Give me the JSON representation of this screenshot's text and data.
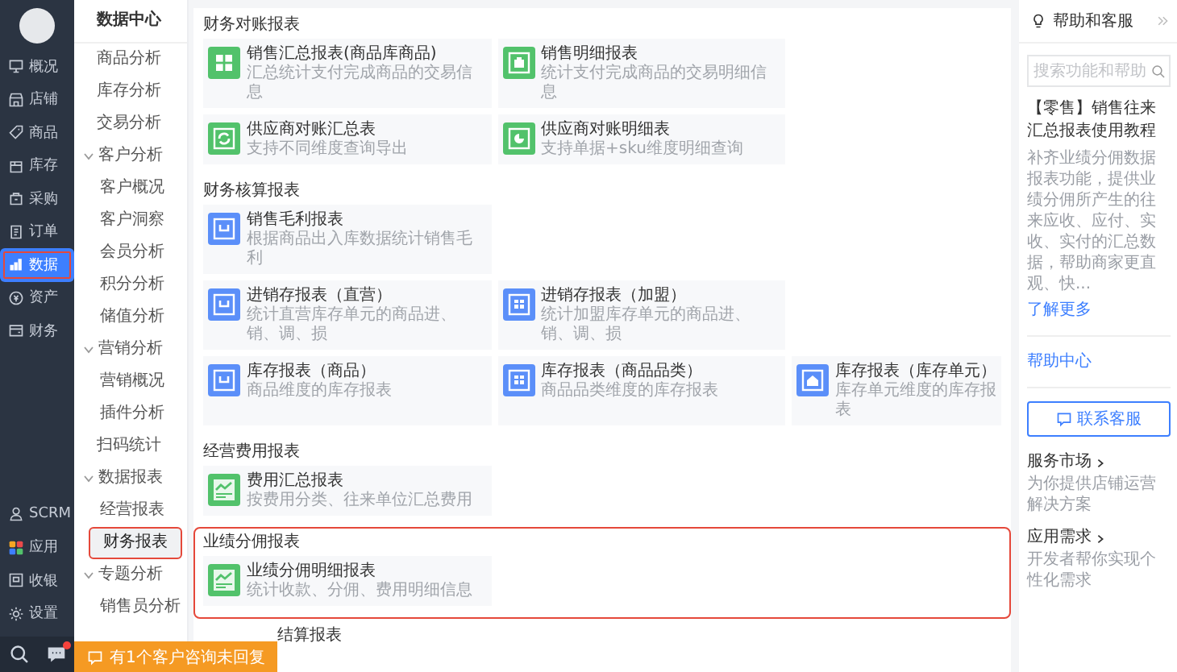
{
  "nav": {
    "items": [
      {
        "label": "概况",
        "selected": false,
        "highlighted": false
      },
      {
        "label": "店铺",
        "selected": false,
        "highlighted": false
      },
      {
        "label": "商品",
        "selected": false,
        "highlighted": false
      },
      {
        "label": "库存",
        "selected": false,
        "highlighted": false
      },
      {
        "label": "采购",
        "selected": false,
        "highlighted": false
      },
      {
        "label": "订单",
        "selected": false,
        "highlighted": false
      },
      {
        "label": "数据",
        "selected": true,
        "highlighted": true
      },
      {
        "label": "资产",
        "selected": false,
        "highlighted": false
      },
      {
        "label": "财务",
        "selected": false,
        "highlighted": false
      }
    ],
    "bottom_items": [
      {
        "label": "SCRM",
        "selected": false
      },
      {
        "label": "应用",
        "selected": false
      },
      {
        "label": "收银",
        "selected": false
      },
      {
        "label": "设置",
        "selected": false
      }
    ]
  },
  "notice": {
    "unread": true,
    "banner": "有1个客户咨询未回复"
  },
  "submenu": {
    "title": "数据中心",
    "items": [
      {
        "label": "商品分析",
        "selected": false,
        "highlighted": false
      },
      {
        "label": "库存分析",
        "selected": false,
        "highlighted": false
      },
      {
        "label": "交易分析",
        "selected": false,
        "highlighted": false
      },
      {
        "label": "客户分析",
        "expanded": true,
        "children": [
          {
            "label": "客户概况",
            "selected": false,
            "highlighted": false
          },
          {
            "label": "客户洞察",
            "selected": false,
            "highlighted": false
          },
          {
            "label": "会员分析",
            "selected": false,
            "highlighted": false
          },
          {
            "label": "积分分析",
            "selected": false,
            "highlighted": false
          },
          {
            "label": "储值分析",
            "selected": false,
            "highlighted": false
          }
        ]
      },
      {
        "label": "营销分析",
        "expanded": true,
        "children": [
          {
            "label": "营销概况",
            "selected": false,
            "highlighted": false
          },
          {
            "label": "插件分析",
            "selected": false,
            "highlighted": false
          }
        ]
      },
      {
        "label": "扫码统计",
        "selected": false,
        "highlighted": false
      },
      {
        "label": "数据报表",
        "expanded": true,
        "children": [
          {
            "label": "经营报表",
            "selected": false,
            "highlighted": false
          },
          {
            "label": "财务报表",
            "selected": true,
            "highlighted": true
          }
        ]
      },
      {
        "label": "专题分析",
        "expanded": true,
        "children": [
          {
            "label": "销售员分析",
            "selected": false,
            "highlighted": false
          }
        ]
      }
    ]
  },
  "sections": [
    {
      "title": "财务对账报表",
      "highlighted": false,
      "rows": [
        [
          {
            "title": "销售汇总报表(商品库商品)",
            "description": "汇总统计支付完成商品的交易信息",
            "color": "#52c26b",
            "kind": "grid"
          },
          {
            "title": "销售明细报表",
            "description": "统计支付完成商品的交易明细信息",
            "color": "#52c26b",
            "kind": "bag"
          }
        ],
        [
          {
            "title": "供应商对账汇总表",
            "description": "支持不同维度查询导出",
            "color": "#52c26b",
            "kind": "cycle"
          },
          {
            "title": "供应商对账明细表",
            "description": "支持单据+sku维度明细查询",
            "color": "#52c26b",
            "kind": "pie"
          }
        ]
      ]
    },
    {
      "title": "财务核算报表",
      "highlighted": false,
      "rows": [
        [
          {
            "title": "销售毛利报表",
            "description": "根据商品出入库数据统计销售毛利",
            "color": "#5b8ff9",
            "kind": "frame"
          }
        ],
        [
          {
            "title": "进销存报表（直营）",
            "description": "统计直营库存单元的商品进、销、调、损",
            "color": "#5b8ff9",
            "kind": "frame"
          },
          {
            "title": "进销存报表（加盟）",
            "description": "统计加盟库存单元的商品进、销、调、损",
            "color": "#5b8ff9",
            "kind": "table"
          }
        ],
        [
          {
            "title": "库存报表（商品）",
            "description": "商品维度的库存报表",
            "color": "#5b8ff9",
            "kind": "frame"
          },
          {
            "title": "库存报表（商品品类）",
            "description": "商品品类维度的库存报表",
            "color": "#5b8ff9",
            "kind": "table"
          },
          {
            "title": "库存报表（库存单元）",
            "description": "库存单元维度的库存报表",
            "color": "#5b8ff9",
            "kind": "house"
          }
        ]
      ]
    },
    {
      "title": "经营费用报表",
      "highlighted": false,
      "rows": [
        [
          {
            "title": "费用汇总报表",
            "description": "按费用分类、往来单位汇总费用",
            "color": "#52c26b",
            "kind": "chart"
          }
        ]
      ]
    },
    {
      "title": "业绩分佣报表",
      "highlighted": true,
      "rows": [
        [
          {
            "title": "业绩分佣明细报表",
            "description": "统计收款、分佣、费用明细信息",
            "color": "#52c26b",
            "kind": "chart"
          }
        ]
      ]
    },
    {
      "title": "结算报表",
      "highlighted": false
    }
  ],
  "help": {
    "title": "帮助和客服",
    "search": {
      "placeholder": "搜索功能和帮助"
    },
    "article": {
      "title": "【零售】销售往来汇总报表使用教程",
      "summary": "补齐业绩分佣数据报表功能，提供业绩分佣所产生的往来应收、应付、实收、实付的汇总数据，帮助商家更直观、快...",
      "link": "了解更多"
    },
    "help_center": "帮助中心",
    "contact_button": "联系客服",
    "links": [
      {
        "title": "服务市场",
        "description": "为你提供店铺运营解决方案"
      },
      {
        "title": "应用需求",
        "description": "开发者帮你实现个性化需求"
      }
    ]
  }
}
